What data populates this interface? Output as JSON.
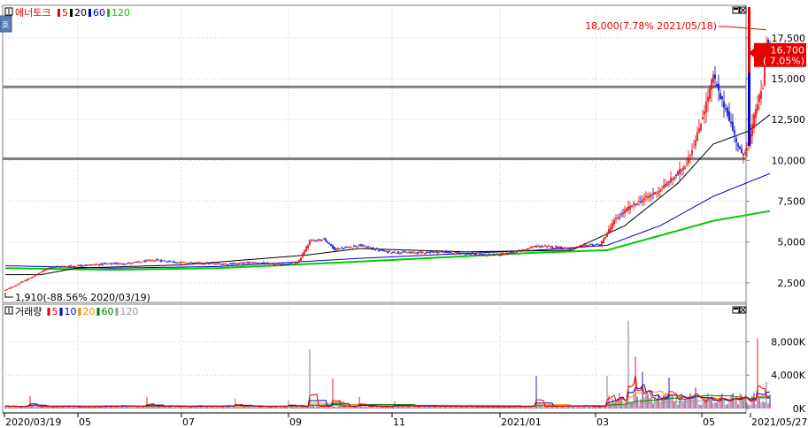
{
  "colors": {
    "up": "#e60000",
    "down": "#0000cc",
    "ma5": "#e60000",
    "ma20": "#000000",
    "ma60": "#0000cc",
    "ma120": "#00cc00",
    "vol_ma5": "#e60000",
    "vol_ma10": "#0000cc",
    "vol_ma20": "#ff8c00",
    "vol_ma60": "#008000",
    "vol_ma120": "#999999",
    "hline": "#808080",
    "badge": "#e60000"
  },
  "price_panel": {
    "legend": [
      {
        "text": "에너토크",
        "color": "#e60000"
      },
      {
        "text": "5",
        "color": "#e60000"
      },
      {
        "text": "20",
        "color": "#000000"
      },
      {
        "text": "60",
        "color": "#0000cc"
      },
      {
        "text": "120",
        "color": "#00cc00"
      }
    ],
    "corner_icon": "호",
    "high_annotation": "18,000(7.78% 2021/05/18)",
    "low_annotation": "1,910(-88.56% 2020/03/19)",
    "current_price": "16,700",
    "current_change": "( 7.05%)"
  },
  "volume_panel": {
    "legend": [
      {
        "text": "거래량",
        "color": "#000000"
      },
      {
        "text": "5",
        "color": "#e60000"
      },
      {
        "text": "10",
        "color": "#0000cc"
      },
      {
        "text": "20",
        "color": "#ff8c00"
      },
      {
        "text": "60",
        "color": "#008000"
      },
      {
        "text": "120",
        "color": "#999999"
      }
    ]
  },
  "chart_data": [
    {
      "type": "candlestick",
      "x_ticks": [
        "2020/03/19",
        "05",
        "07",
        "09",
        "11",
        "2021/01",
        "03",
        "05",
        "2021/05/27"
      ],
      "y_ticks": [
        "2,500",
        "5,000",
        "7,500",
        "10,000",
        "12,500",
        "15,000",
        "17,500"
      ],
      "ylim": [
        1300,
        19500
      ],
      "horizontal_lines": [
        14500,
        10100
      ],
      "high_point": {
        "date": "2021/05/18",
        "value": 18000
      },
      "low_point": {
        "date": "2020/03/19",
        "value": 1910
      },
      "last_price": 16700,
      "series": [
        {
          "name": "5",
          "values": []
        },
        {
          "name": "20",
          "values": []
        },
        {
          "name": "60",
          "values": []
        },
        {
          "name": "120",
          "values": []
        }
      ],
      "close_anchors": [
        [
          0,
          2050
        ],
        [
          14,
          2800
        ],
        [
          25,
          3450
        ],
        [
          40,
          3550
        ],
        [
          55,
          3650
        ],
        [
          70,
          3700
        ],
        [
          85,
          3900
        ],
        [
          98,
          3750
        ],
        [
          110,
          3700
        ],
        [
          125,
          3650
        ],
        [
          140,
          3750
        ],
        [
          155,
          3600
        ],
        [
          165,
          3700
        ],
        [
          172,
          5050
        ],
        [
          180,
          5200
        ],
        [
          186,
          4550
        ],
        [
          200,
          4800
        ],
        [
          215,
          4400
        ],
        [
          230,
          4350
        ],
        [
          245,
          4400
        ],
        [
          260,
          4300
        ],
        [
          270,
          4200
        ],
        [
          280,
          4250
        ],
        [
          290,
          4450
        ],
        [
          300,
          4750
        ],
        [
          310,
          4700
        ],
        [
          320,
          4600
        ],
        [
          330,
          4850
        ],
        [
          336,
          4800
        ],
        [
          344,
          6300
        ],
        [
          352,
          7100
        ],
        [
          360,
          7600
        ],
        [
          370,
          8200
        ],
        [
          378,
          9000
        ],
        [
          384,
          9700
        ],
        [
          390,
          11200
        ],
        [
          396,
          13500
        ],
        [
          400,
          15200
        ],
        [
          404,
          13800
        ],
        [
          408,
          12900
        ],
        [
          412,
          11500
        ],
        [
          416,
          10300
        ],
        [
          420,
          11000
        ],
        [
          424,
          13200
        ],
        [
          428,
          14500
        ],
        [
          430,
          17200
        ],
        [
          432,
          16700
        ]
      ],
      "ma_anchors": {
        "120": [
          [
            0,
            3400
          ],
          [
            60,
            3300
          ],
          [
            120,
            3400
          ],
          [
            200,
            3800
          ],
          [
            300,
            4350
          ],
          [
            340,
            4500
          ],
          [
            370,
            5400
          ],
          [
            400,
            6300
          ],
          [
            432,
            6900
          ]
        ],
        "60": [
          [
            0,
            3550
          ],
          [
            60,
            3400
          ],
          [
            120,
            3500
          ],
          [
            200,
            4000
          ],
          [
            300,
            4500
          ],
          [
            340,
            4800
          ],
          [
            370,
            6000
          ],
          [
            400,
            7800
          ],
          [
            432,
            9200
          ]
        ],
        "20": [
          [
            0,
            3000
          ],
          [
            20,
            3000
          ],
          [
            40,
            3400
          ],
          [
            100,
            3600
          ],
          [
            170,
            4200
          ],
          [
            200,
            4600
          ],
          [
            260,
            4400
          ],
          [
            320,
            4500
          ],
          [
            350,
            6000
          ],
          [
            380,
            8600
          ],
          [
            400,
            11000
          ],
          [
            420,
            11800
          ],
          [
            432,
            12800
          ]
        ]
      }
    },
    {
      "type": "bar",
      "title": "",
      "y_ticks": [
        "0K",
        "4,000K",
        "8,000K"
      ],
      "ylim": [
        0,
        11000
      ],
      "spikes": [
        [
          14,
          1500
        ],
        [
          80,
          1400
        ],
        [
          130,
          1200
        ],
        [
          160,
          1000
        ],
        [
          172,
          7100
        ],
        [
          185,
          3600
        ],
        [
          200,
          1400
        ],
        [
          220,
          900
        ],
        [
          300,
          3900
        ],
        [
          340,
          3900
        ],
        [
          352,
          10500
        ],
        [
          356,
          6200
        ],
        [
          360,
          4400
        ],
        [
          375,
          3700
        ],
        [
          390,
          2500
        ],
        [
          410,
          1600
        ],
        [
          425,
          8400
        ],
        [
          430,
          3200
        ]
      ]
    }
  ]
}
